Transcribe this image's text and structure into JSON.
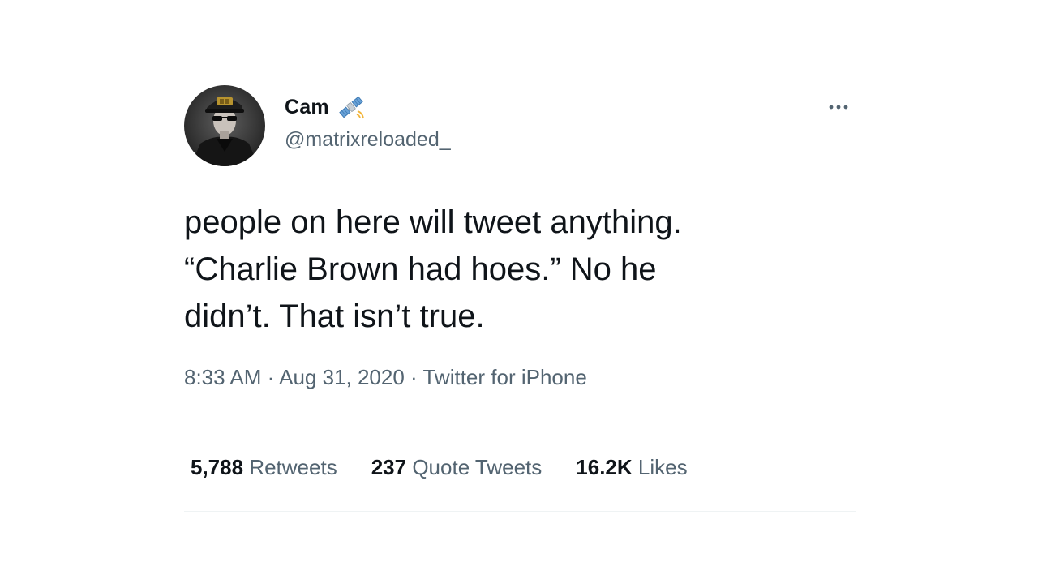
{
  "user": {
    "display_name": "Cam",
    "name_emoji": "satellite",
    "handle": "@matrixreloaded_"
  },
  "tweet": {
    "lines": [
      "people on here will tweet anything.",
      "“Charlie Brown had hoes.” No he",
      "didn’t. That isn’t true."
    ],
    "time": "8:33 AM",
    "date": "Aug 31, 2020",
    "source": "Twitter for iPhone",
    "separator": "·"
  },
  "stats": {
    "retweets_count": "5,788",
    "retweets_label": "Retweets",
    "quotes_count": "237",
    "quotes_label": "Quote Tweets",
    "likes_count": "16.2K",
    "likes_label": "Likes"
  },
  "colors": {
    "text_primary": "#0f1419",
    "text_secondary": "#536471",
    "divider": "#eff3f4",
    "background": "#ffffff"
  },
  "icons": {
    "more": "more-options-icon",
    "name_badge": "satellite-icon",
    "avatar": "profile-avatar"
  }
}
